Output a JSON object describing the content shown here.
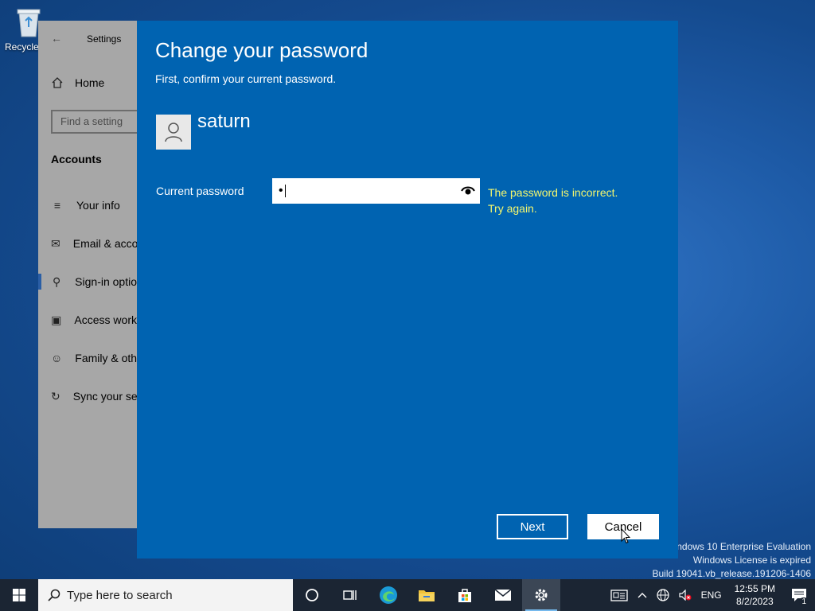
{
  "desktop": {
    "recycle_bin_label": "Recycle",
    "watermark": {
      "line1": "Windows 10 Enterprise Evaluation",
      "line2": "Windows License is expired",
      "line3": "Build 19041.vb_release.191206-1406"
    }
  },
  "settings_window": {
    "title": "Settings",
    "home_label": "Home",
    "search_placeholder": "Find a setting",
    "section_title": "Accounts",
    "nav_items": [
      {
        "label": "Your info",
        "icon": "person-card-icon"
      },
      {
        "label": "Email & acco",
        "icon": "mail-icon"
      },
      {
        "label": "Sign-in optio",
        "icon": "key-icon",
        "active": true
      },
      {
        "label": "Access work",
        "icon": "briefcase-icon"
      },
      {
        "label": "Family & oth",
        "icon": "person-add-icon"
      },
      {
        "label": "Sync your se",
        "icon": "sync-icon"
      }
    ]
  },
  "dialog": {
    "title": "Change your password",
    "subtitle": "First, confirm your current password.",
    "username": "saturn",
    "password_label": "Current password",
    "password_value": "•",
    "error_line1": "The password is incorrect.",
    "error_line2": "Try again.",
    "next_label": "Next",
    "cancel_label": "Cancel",
    "colors": {
      "background": "#0063b1",
      "error": "#f4f76e"
    }
  },
  "taskbar": {
    "search_placeholder": "Type here to search",
    "apps": [
      "cortana-icon",
      "task-view-icon",
      "edge-icon",
      "file-explorer-icon",
      "store-icon",
      "mail-icon",
      "settings-icon"
    ],
    "active_app": "settings-icon",
    "language": "ENG",
    "time": "12:55 PM",
    "date": "8/2/2023",
    "notification_count": "1"
  }
}
